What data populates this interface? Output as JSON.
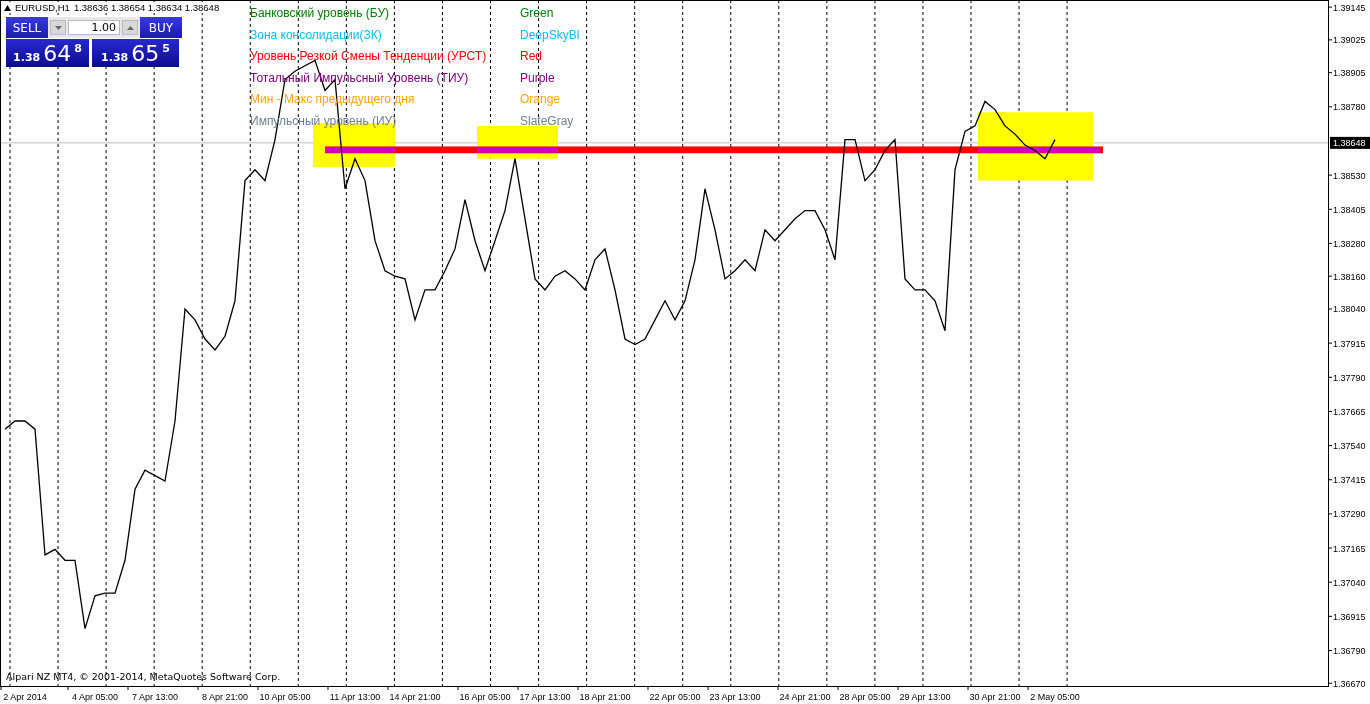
{
  "chart_header": {
    "symbol": "EURUSD,H1",
    "quotes": "1.38636 1.38654 1.38634 1.38648"
  },
  "trade_panel": {
    "sell_label": "SELL",
    "buy_label": "BUY",
    "lot": "1.00",
    "sell_price": {
      "big": "1.38",
      "main": "64",
      "pip": "8"
    },
    "buy_price": {
      "big": "1.38",
      "main": "65",
      "pip": "5"
    }
  },
  "legend": [
    {
      "label": "Банковский уровень (БУ)",
      "color_name": "Green",
      "color": "#008000"
    },
    {
      "label": "Зона консолидации(ЗК)",
      "color_name": "DeepSkyBl",
      "color": "#00bfff"
    },
    {
      "label": "Уровень Резкой Смены Тенденции (УРСТ)",
      "color_name": "Red",
      "color": "#ff0000"
    },
    {
      "label": "Тотальный Импульсный Уровень (ТИУ)",
      "color_name": "Purple",
      "color": "#800080"
    },
    {
      "label": "Мин - Макс предыдущего дня",
      "color_name": "Orange",
      "color": "#ffa500"
    },
    {
      "label": "Импульсный уровень (ИУ)",
      "color_name": "SlateGray",
      "color": "#708090"
    }
  ],
  "chart_data": {
    "type": "line",
    "grid": true,
    "ylim": [
      1.3666,
      1.39171
    ],
    "categories": [
      null,
      null,
      "2 Apr 2014",
      null,
      null,
      null,
      null,
      null,
      null,
      "4 Apr 05:00",
      null,
      null,
      null,
      null,
      null,
      "7 Apr 13:00",
      null,
      null,
      null,
      null,
      null,
      null,
      "8 Apr 21:00",
      null,
      null,
      null,
      null,
      null,
      "10 Apr 05:00",
      null,
      null,
      null,
      null,
      null,
      null,
      "11 Apr 13:00",
      null,
      null,
      null,
      null,
      null,
      "14 Apr 21:00",
      null,
      null,
      null,
      null,
      null,
      null,
      "16 Apr 05:00",
      null,
      null,
      null,
      null,
      null,
      "17 Apr 13:00",
      null,
      null,
      null,
      null,
      null,
      "18 Apr 21:00",
      null,
      null,
      null,
      null,
      null,
      null,
      "22 Apr 05:00",
      null,
      null,
      null,
      null,
      null,
      "23 Apr 13:00",
      null,
      null,
      null,
      null,
      null,
      null,
      "24 Apr 21:00",
      null,
      null,
      null,
      null,
      null,
      "28 Apr 05:00",
      null,
      null,
      null,
      null,
      null,
      "29 Apr 13:00",
      null,
      null,
      null,
      null,
      null,
      null,
      "30 Apr 21:00",
      null,
      null,
      null,
      null,
      null,
      "2 May 05:00"
    ],
    "series": [
      {
        "color": "#000000",
        "values": [
          1.376,
          1.3763,
          1.3763,
          1.376,
          1.3714,
          1.3716,
          1.3712,
          1.3712,
          1.3687,
          1.3699,
          1.37,
          1.37,
          1.3712,
          1.3738,
          1.3745,
          1.3743,
          1.3741,
          1.3763,
          1.3804,
          1.38,
          1.3793,
          1.3789,
          1.3794,
          1.3807,
          1.3851,
          1.3855,
          1.3851,
          1.3866,
          1.3888,
          1.3891,
          1.3893,
          1.3895,
          1.3884,
          1.3888,
          1.3848,
          1.3859,
          1.3851,
          1.3829,
          1.3818,
          1.3816,
          1.3815,
          1.38,
          1.3811,
          1.3811,
          1.3818,
          1.3826,
          1.3844,
          1.3829,
          1.3818,
          1.3829,
          1.384,
          1.3859,
          1.3837,
          1.3815,
          1.3811,
          1.3816,
          1.3818,
          1.3815,
          1.3811,
          1.3822,
          1.3826,
          1.3811,
          1.3793,
          1.3791,
          1.3793,
          1.38,
          1.3807,
          1.38,
          1.3807,
          1.3822,
          1.3848,
          1.3833,
          1.3815,
          1.3818,
          1.3822,
          1.3818,
          1.3833,
          1.3829,
          1.3833,
          1.3837,
          1.384,
          1.384,
          1.3833,
          1.3822,
          1.3866,
          1.3866,
          1.3851,
          1.3855,
          1.3862,
          1.3866,
          1.3815,
          1.3811,
          1.3811,
          1.3807,
          1.3796,
          1.3855,
          1.3869,
          1.3871,
          1.388,
          1.3877,
          1.3871,
          1.3868,
          1.3864,
          1.3862,
          1.3859,
          1.3866
        ]
      }
    ],
    "yticks": [
      {
        "value": 1.39145,
        "label": "1.39145"
      },
      {
        "value": 1.39025,
        "label": "1.39025"
      },
      {
        "value": 1.38905,
        "label": "1.38905"
      },
      {
        "value": 1.3878,
        "label": "1.38780"
      },
      {
        "value": 1.3853,
        "label": "1.38530"
      },
      {
        "value": 1.38405,
        "label": "1.38405"
      },
      {
        "value": 1.3828,
        "label": "1.38280"
      },
      {
        "value": 1.3816,
        "label": "1.38160"
      },
      {
        "value": 1.3804,
        "label": "1.38040"
      },
      {
        "value": 1.37915,
        "label": "1.37915"
      },
      {
        "value": 1.3779,
        "label": "1.37790"
      },
      {
        "value": 1.37665,
        "label": "1.37665"
      },
      {
        "value": 1.3754,
        "label": "1.37540"
      },
      {
        "value": 1.37415,
        "label": "1.37415"
      },
      {
        "value": 1.3729,
        "label": "1.37290"
      },
      {
        "value": 1.37165,
        "label": "1.37165"
      },
      {
        "value": 1.3704,
        "label": "1.37040"
      },
      {
        "value": 1.36915,
        "label": "1.36915"
      },
      {
        "value": 1.3679,
        "label": "1.36790"
      },
      {
        "value": 1.3667,
        "label": "1.36670"
      }
    ],
    "bands": [
      {
        "axis": "y",
        "from": 1.3856,
        "to": 1.3872,
        "color": "#ffff00"
      },
      {
        "axis": "y",
        "from": 1.3859,
        "to": 1.3871,
        "color": "#ffff00"
      },
      {
        "axis": "y",
        "from": 1.3851,
        "to": 1.3876,
        "color": "#ffff00"
      },
      {
        "axis": "y",
        "from": 1.3861,
        "to": 1.38635,
        "color": "#ff0000"
      },
      {
        "axis": "y",
        "from": 1.38612,
        "to": 1.38632,
        "color": "#cc00cc"
      },
      {
        "axis": "y",
        "from": 1.38612,
        "to": 1.38632,
        "color": "#cc00cc"
      },
      {
        "axis": "y",
        "from": 1.38612,
        "to": 1.38632,
        "color": "#cc00cc"
      }
    ],
    "ref_lines": [
      {
        "axis": "y",
        "value": 1.38648,
        "label": "1.38648"
      }
    ]
  },
  "copyright": "Alpari NZ MT4, © 2001-2014, MetaQuotes Software Corp."
}
